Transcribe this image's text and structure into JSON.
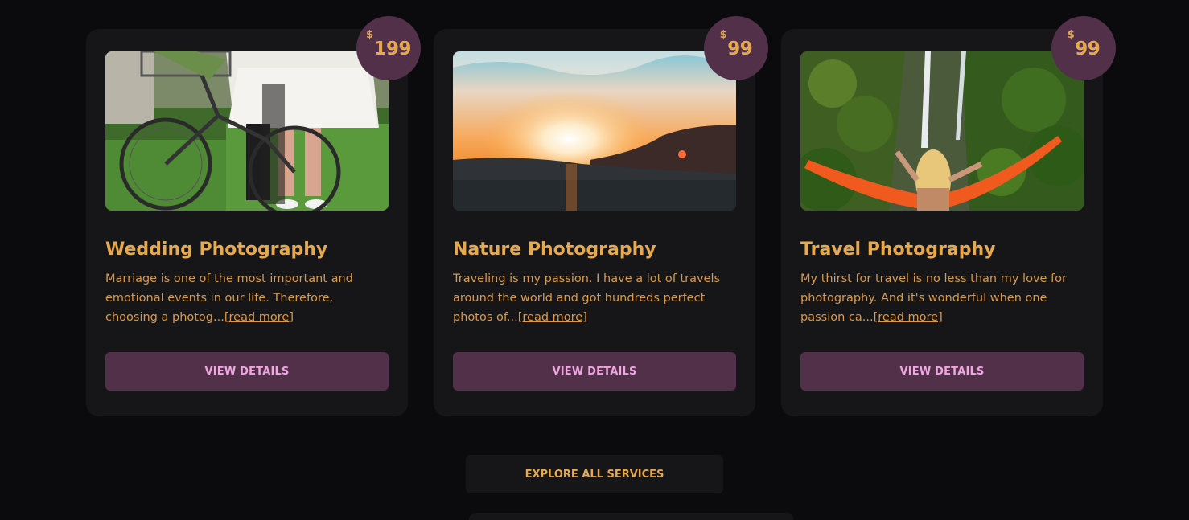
{
  "cards": [
    {
      "price_currency": "$",
      "price_amount": "199",
      "title": "Wedding Photography",
      "description": "Marriage is one of the most important and emotional events in our life. Therefore, choosing a photog...",
      "read_more": "[read more]",
      "button_label": "VIEW DETAILS",
      "image": "wedding-bicycle-photo"
    },
    {
      "price_currency": "$",
      "price_amount": "99",
      "title": "Nature Photography",
      "description": "Traveling is my passion. I have a lot of travels around the world and got hundreds perfect photos of...",
      "read_more": "[read more]",
      "button_label": "VIEW DETAILS",
      "image": "sunset-mountains-photo"
    },
    {
      "price_currency": "$",
      "price_amount": "99",
      "title": "Travel Photography",
      "description": "My thirst for travel is no less than my love for photography. And it's wonderful when one passion ca...",
      "read_more": "[read more]",
      "button_label": "VIEW DETAILS",
      "image": "waterfall-hammock-photo"
    }
  ],
  "explore_button": "EXPLORE ALL SERVICES",
  "colors": {
    "background": "#0b0b0d",
    "card": "#161618",
    "accent_purple": "#52304a",
    "gold_text": "#e6a94e",
    "pink_text": "#f0a6e0"
  }
}
